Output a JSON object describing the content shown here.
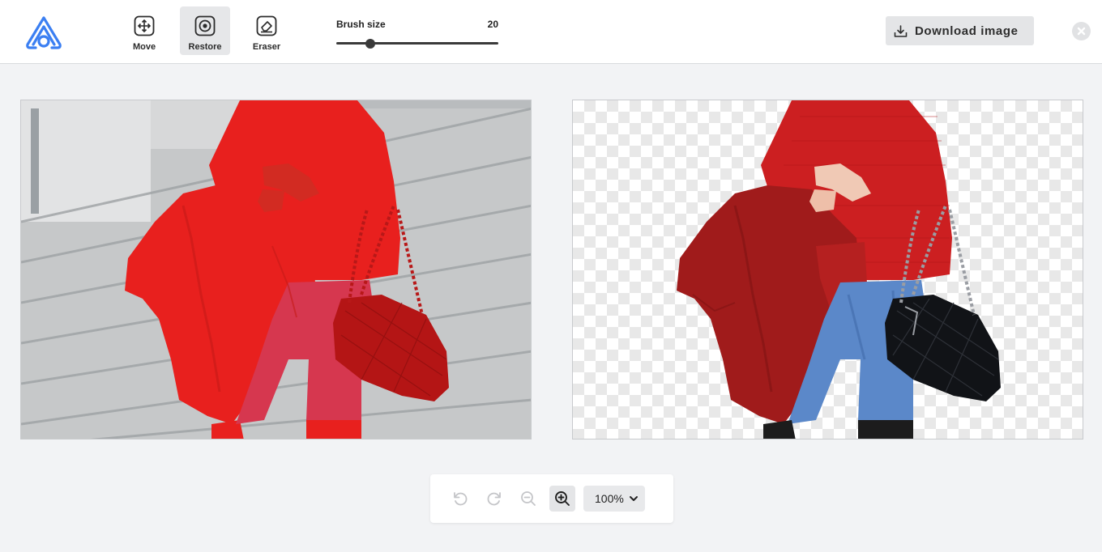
{
  "app": {
    "logo_icon": "app-logo-icon",
    "accent_color": "#3b7ff2"
  },
  "toolbar": {
    "tools": [
      {
        "label": "Move",
        "icon": "move-icon",
        "active": false
      },
      {
        "label": "Restore",
        "icon": "restore-icon",
        "active": true
      },
      {
        "label": "Eraser",
        "icon": "eraser-icon",
        "active": false
      }
    ],
    "brush": {
      "label": "Brush size",
      "value": "20",
      "fraction": 0.21
    },
    "download_label": "Download image",
    "download_icon": "download-icon",
    "close_icon": "close-icon"
  },
  "canvas": {
    "original_tint": "#e8201e",
    "checker_colors": [
      "#ffffff",
      "#e8e8e8"
    ]
  },
  "zoom": {
    "undo_icon": "undo-icon",
    "redo_icon": "redo-icon",
    "zoom_out_icon": "zoom-out-icon",
    "zoom_in_icon": "zoom-in-icon",
    "level": "100%"
  }
}
